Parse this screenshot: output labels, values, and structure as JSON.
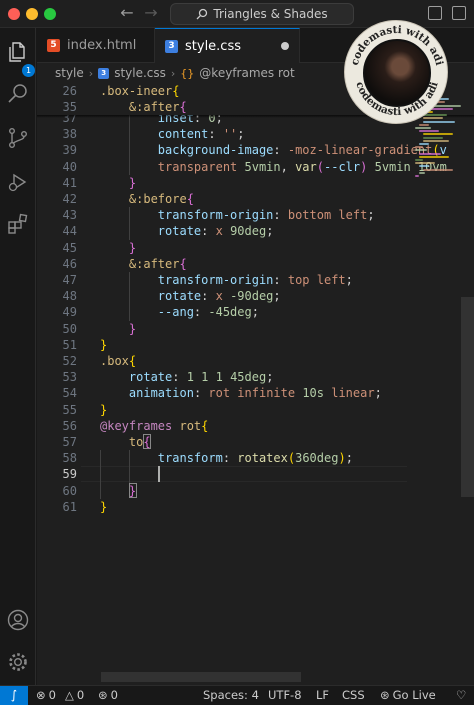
{
  "window": {
    "command_center": "Triangles & Shades"
  },
  "tabs": [
    {
      "label": "index.html",
      "type_badge": "5"
    },
    {
      "label": "style.css",
      "type_badge": "3"
    }
  ],
  "activity_bar": {
    "explorer_badge": "1"
  },
  "breadcrumb": {
    "folder": "style",
    "file": "style.css",
    "symbol": "@keyframes rot"
  },
  "editor": {
    "sticky_lines": [
      {
        "n": "26",
        "tokens": [
          [
            "k-sel",
            ".box-ineer"
          ],
          [
            "k-br1",
            "{"
          ]
        ]
      },
      {
        "n": "35",
        "tokens": [
          [
            "k-punc",
            "    "
          ],
          [
            "k-sel",
            "&:after"
          ],
          [
            "k-br2",
            "{"
          ]
        ]
      }
    ],
    "lines": [
      {
        "n": "37",
        "tokens": [
          [
            "k-punc",
            "        "
          ],
          [
            "k-prop",
            "inset"
          ],
          [
            "k-punc",
            ": "
          ],
          [
            "k-num",
            "0"
          ],
          [
            "k-punc",
            ";"
          ]
        ]
      },
      {
        "n": "38",
        "tokens": [
          [
            "k-punc",
            "        "
          ],
          [
            "k-prop",
            "content"
          ],
          [
            "k-punc",
            ": "
          ],
          [
            "k-val",
            "''"
          ],
          [
            "k-punc",
            ";"
          ]
        ]
      },
      {
        "n": "39",
        "tokens": [
          [
            "k-punc",
            "        "
          ],
          [
            "k-prop",
            "background-image"
          ],
          [
            "k-punc",
            ": "
          ],
          [
            "k-val",
            "-moz-linear-gradient"
          ],
          [
            "k-br1",
            "("
          ],
          [
            "k-prop",
            "v"
          ]
        ]
      },
      {
        "n": "40",
        "tokens": [
          [
            "k-punc",
            "        "
          ],
          [
            "k-val",
            "transparent "
          ],
          [
            "k-num",
            "5vmin"
          ],
          [
            "k-punc",
            ", "
          ],
          [
            "k-var",
            "var"
          ],
          [
            "k-br2",
            "("
          ],
          [
            "k-prop",
            "--clr"
          ],
          [
            "k-br2",
            ")"
          ],
          [
            "k-punc",
            " "
          ],
          [
            "k-num",
            "5vmin 10vm"
          ]
        ]
      },
      {
        "n": "41",
        "tokens": [
          [
            "k-punc",
            "    "
          ],
          [
            "k-br2",
            "}"
          ]
        ]
      },
      {
        "n": "42",
        "tokens": [
          [
            "k-punc",
            "    "
          ],
          [
            "k-sel",
            "&:before"
          ],
          [
            "k-br2",
            "{"
          ]
        ]
      },
      {
        "n": "43",
        "tokens": [
          [
            "k-punc",
            "        "
          ],
          [
            "k-prop",
            "transform-origin"
          ],
          [
            "k-punc",
            ": "
          ],
          [
            "k-val",
            "bottom left"
          ],
          [
            "k-punc",
            ";"
          ]
        ]
      },
      {
        "n": "44",
        "tokens": [
          [
            "k-punc",
            "        "
          ],
          [
            "k-prop",
            "rotate"
          ],
          [
            "k-punc",
            ": "
          ],
          [
            "k-val",
            "x "
          ],
          [
            "k-num",
            "90deg"
          ],
          [
            "k-punc",
            ";"
          ]
        ]
      },
      {
        "n": "45",
        "tokens": [
          [
            "k-punc",
            "    "
          ],
          [
            "k-br2",
            "}"
          ]
        ]
      },
      {
        "n": "46",
        "tokens": [
          [
            "k-punc",
            "    "
          ],
          [
            "k-sel",
            "&:after"
          ],
          [
            "k-br2",
            "{"
          ]
        ]
      },
      {
        "n": "47",
        "tokens": [
          [
            "k-punc",
            "        "
          ],
          [
            "k-prop",
            "transform-origin"
          ],
          [
            "k-punc",
            ": "
          ],
          [
            "k-val",
            "top left"
          ],
          [
            "k-punc",
            ";"
          ]
        ]
      },
      {
        "n": "48",
        "tokens": [
          [
            "k-punc",
            "        "
          ],
          [
            "k-prop",
            "rotate"
          ],
          [
            "k-punc",
            ": "
          ],
          [
            "k-val",
            "x "
          ],
          [
            "k-num",
            "-90deg"
          ],
          [
            "k-punc",
            ";"
          ]
        ]
      },
      {
        "n": "49",
        "tokens": [
          [
            "k-punc",
            "        "
          ],
          [
            "k-prop",
            "--ang"
          ],
          [
            "k-punc",
            ": "
          ],
          [
            "k-num",
            "-45deg"
          ],
          [
            "k-punc",
            ";"
          ]
        ]
      },
      {
        "n": "50",
        "tokens": [
          [
            "k-punc",
            "    "
          ],
          [
            "k-br2",
            "}"
          ]
        ]
      },
      {
        "n": "51",
        "tokens": [
          [
            "k-br1",
            "}"
          ]
        ]
      },
      {
        "n": "52",
        "tokens": [
          [
            "k-sel",
            ".box"
          ],
          [
            "k-br1",
            "{"
          ]
        ]
      },
      {
        "n": "53",
        "tokens": [
          [
            "k-punc",
            "    "
          ],
          [
            "k-prop",
            "rotate"
          ],
          [
            "k-punc",
            ": "
          ],
          [
            "k-num",
            "1 1 1 45deg"
          ],
          [
            "k-punc",
            ";"
          ]
        ]
      },
      {
        "n": "54",
        "tokens": [
          [
            "k-punc",
            "    "
          ],
          [
            "k-prop",
            "animation"
          ],
          [
            "k-punc",
            ": "
          ],
          [
            "k-val",
            "rot infinite "
          ],
          [
            "k-num",
            "10s"
          ],
          [
            "k-val",
            " linear"
          ],
          [
            "k-punc",
            ";"
          ]
        ]
      },
      {
        "n": "55",
        "tokens": [
          [
            "k-br1",
            "}"
          ]
        ]
      },
      {
        "n": "56",
        "tokens": [
          [
            "k-at",
            "@keyframes "
          ],
          [
            "k-sel",
            "rot"
          ],
          [
            "k-br1",
            "{"
          ]
        ]
      },
      {
        "n": "57",
        "tokens": [
          [
            "k-punc",
            "    "
          ],
          [
            "k-sel",
            "to"
          ],
          [
            "k-br2",
            "{"
          ]
        ]
      },
      {
        "n": "58",
        "tokens": [
          [
            "k-punc",
            "        "
          ],
          [
            "k-prop",
            "transform"
          ],
          [
            "k-punc",
            ": "
          ],
          [
            "k-fn",
            "rotatex"
          ],
          [
            "k-br1",
            "("
          ],
          [
            "k-num",
            "360deg"
          ],
          [
            "k-br1",
            ")"
          ],
          [
            "k-punc",
            ";"
          ]
        ]
      },
      {
        "n": "59",
        "tokens": [
          [
            "k-punc",
            "        "
          ]
        ]
      },
      {
        "n": "60",
        "tokens": [
          [
            "k-punc",
            "    "
          ],
          [
            "k-br2",
            "}"
          ]
        ]
      },
      {
        "n": "61",
        "tokens": [
          [
            "k-br1",
            "}"
          ]
        ]
      }
    ],
    "active_line": "59"
  },
  "watermark": {
    "text": "codemasti with adi"
  },
  "statusbar": {
    "errors": "0",
    "warnings": "0",
    "ports": "0",
    "spaces": "Spaces: 4",
    "encoding": "UTF-8",
    "eol": "LF",
    "language": "CSS",
    "live": "Go Live"
  }
}
